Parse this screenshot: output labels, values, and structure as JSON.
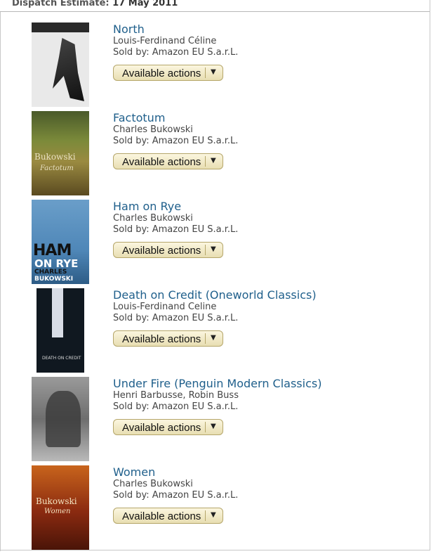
{
  "header": {
    "label": "Dispatch Estimate:",
    "date": "17 May 2011"
  },
  "items": [
    {
      "title": "North",
      "author": "Louis-Ferdinand Céline",
      "seller": "Sold by: Amazon EU S.a.r.L.",
      "button": "Available actions"
    },
    {
      "title": "Factotum",
      "author": "Charles Bukowski",
      "seller": "Sold by: Amazon EU S.a.r.L.",
      "button": "Available actions",
      "cover_text": [
        "Bukowski",
        "Factotum"
      ]
    },
    {
      "title": "Ham on Rye",
      "author": "Charles Bukowski",
      "seller": "Sold by: Amazon EU S.a.r.L.",
      "button": "Available actions",
      "cover_text": [
        "HAM",
        "ON RYE",
        "CHARLES",
        "BUKOWSKI"
      ]
    },
    {
      "title": "Death on Credit (Oneworld Classics)",
      "author": "Louis-Ferdinand Celine",
      "seller": "Sold by: Amazon EU S.a.r.L.",
      "button": "Available actions",
      "cover_text": [
        "DEATH ON CREDIT"
      ]
    },
    {
      "title": "Under Fire (Penguin Modern Classics)",
      "author": "Henri Barbusse, Robin Buss",
      "seller": "Sold by: Amazon EU S.a.r.L.",
      "button": "Available actions"
    },
    {
      "title": "Women",
      "author": "Charles Bukowski",
      "seller": "Sold by: Amazon EU S.a.r.L.",
      "button": "Available actions",
      "cover_text": [
        "Bukowski",
        "Women"
      ]
    }
  ]
}
